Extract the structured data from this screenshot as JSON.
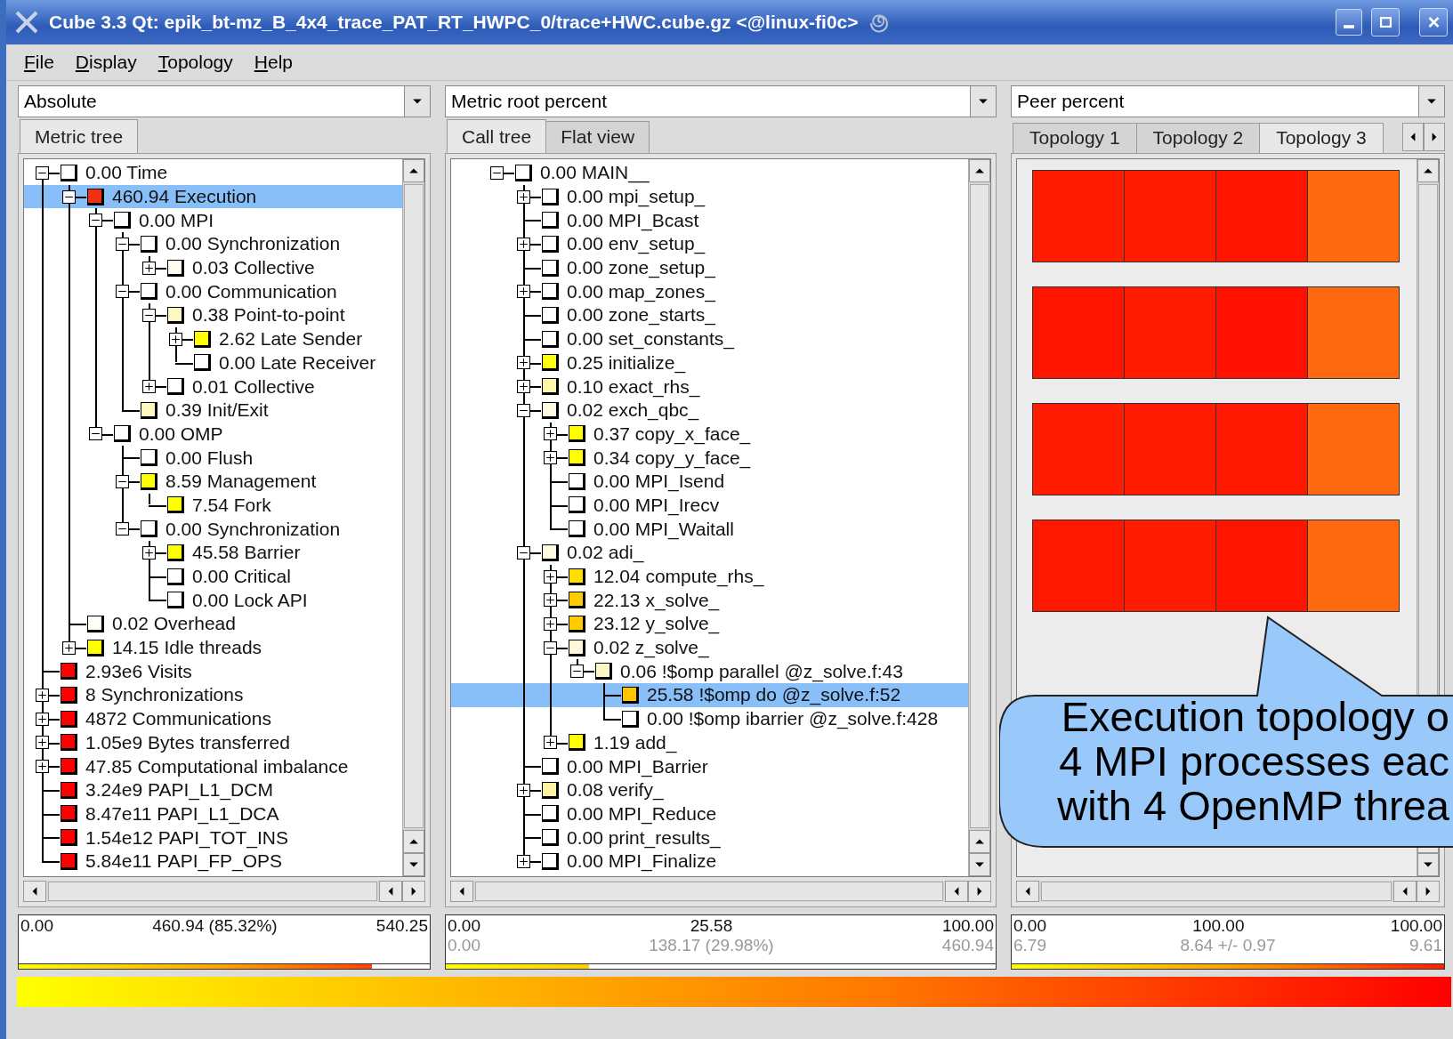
{
  "window": {
    "title": "Cube 3.3 Qt: epik_bt-mz_B_4x4_trace_PAT_RT_HWPC_0/trace+HWC.cube.gz <@linux-fi0c>"
  },
  "menu": [
    "File",
    "Display",
    "Topology",
    "Help"
  ],
  "panels": [
    {
      "kind": "metric_tree",
      "selector": "Absolute",
      "tabs": [
        {
          "label": "Metric tree",
          "selected": true
        }
      ],
      "tree": [
        {
          "text": "0.00 Time",
          "color": "#ffffff",
          "kind": "branch",
          "expanded": true,
          "selected": false,
          "children": [
            {
              "text": "460.94 Execution",
              "color": "#f0300f",
              "kind": "branch",
              "expanded": true,
              "selected": true,
              "children": [
                {
                  "text": "0.00 MPI",
                  "color": "#ffffff",
                  "kind": "branch",
                  "expanded": true,
                  "selected": false,
                  "children": [
                    {
                      "text": "0.00 Synchronization",
                      "color": "#ffffff",
                      "kind": "branch",
                      "expanded": true,
                      "selected": false,
                      "children": [
                        {
                          "text": "0.03 Collective",
                          "color": "#fffdf0",
                          "kind": "branch",
                          "expanded": false,
                          "selected": false
                        }
                      ]
                    },
                    {
                      "text": "0.00 Communication",
                      "color": "#ffffff",
                      "kind": "branch",
                      "expanded": true,
                      "selected": false,
                      "children": [
                        {
                          "text": "0.38 Point-to-point",
                          "color": "#fff8c0",
                          "kind": "branch",
                          "expanded": true,
                          "selected": false,
                          "children": [
                            {
                              "text": "2.62 Late Sender",
                              "color": "#ffff00",
                              "kind": "branch",
                              "expanded": false,
                              "selected": false
                            },
                            {
                              "text": "0.00 Late Receiver",
                              "color": "#ffffff",
                              "kind": "leaf",
                              "selected": false
                            }
                          ]
                        },
                        {
                          "text": "0.01 Collective",
                          "color": "#ffffff",
                          "kind": "branch",
                          "expanded": false,
                          "selected": false
                        }
                      ]
                    },
                    {
                      "text": "0.39 Init/Exit",
                      "color": "#fff8c0",
                      "kind": "leaf",
                      "selected": false
                    }
                  ]
                },
                {
                  "text": "0.00 OMP",
                  "color": "#ffffff",
                  "kind": "branch",
                  "expanded": true,
                  "selected": false,
                  "children": [
                    {
                      "text": "0.00 Flush",
                      "color": "#ffffff",
                      "kind": "leaf",
                      "selected": false
                    },
                    {
                      "text": "8.59 Management",
                      "color": "#ffff00",
                      "kind": "branch",
                      "expanded": true,
                      "selected": false,
                      "children": [
                        {
                          "text": "7.54 Fork",
                          "color": "#ffff00",
                          "kind": "leaf",
                          "selected": false
                        }
                      ]
                    },
                    {
                      "text": "0.00 Synchronization",
                      "color": "#ffffff",
                      "kind": "branch",
                      "expanded": true,
                      "selected": false,
                      "children": [
                        {
                          "text": "45.58 Barrier",
                          "color": "#ffff00",
                          "kind": "branch",
                          "expanded": false,
                          "selected": false
                        },
                        {
                          "text": "0.00 Critical",
                          "color": "#ffffff",
                          "kind": "leaf",
                          "selected": false
                        },
                        {
                          "text": "0.00 Lock API",
                          "color": "#ffffff",
                          "kind": "leaf",
                          "selected": false
                        }
                      ]
                    }
                  ]
                }
              ]
            },
            {
              "text": "0.02 Overhead",
              "color": "#fffef5",
              "kind": "leaf",
              "selected": false
            },
            {
              "text": "14.15 Idle threads",
              "color": "#ffff00",
              "kind": "branch",
              "expanded": false,
              "selected": false
            }
          ]
        },
        {
          "text": "2.93e6 Visits",
          "color": "#ff0000",
          "kind": "leaf",
          "selected": false
        },
        {
          "text": "8 Synchronizations",
          "color": "#ff0000",
          "kind": "branch",
          "expanded": false,
          "selected": false
        },
        {
          "text": "4872 Communications",
          "color": "#ff0000",
          "kind": "branch",
          "expanded": false,
          "selected": false
        },
        {
          "text": "1.05e9 Bytes transferred",
          "color": "#ff0000",
          "kind": "branch",
          "expanded": false,
          "selected": false
        },
        {
          "text": "47.85 Computational imbalance",
          "color": "#ff0000",
          "kind": "branch",
          "expanded": false,
          "selected": false
        },
        {
          "text": "3.24e9 PAPI_L1_DCM",
          "color": "#ff0000",
          "kind": "leaf",
          "selected": false
        },
        {
          "text": "8.47e11 PAPI_L1_DCA",
          "color": "#ff0000",
          "kind": "leaf",
          "selected": false
        },
        {
          "text": "1.54e12 PAPI_TOT_INS",
          "color": "#ff0000",
          "kind": "leaf",
          "selected": false
        },
        {
          "text": "5.84e11 PAPI_FP_OPS",
          "color": "#ff0000",
          "kind": "leaf",
          "selected": false
        }
      ],
      "stats": {
        "min": "0.00",
        "value": "460.94 (85.32%)",
        "max": "540.25",
        "level": 0.86
      }
    },
    {
      "kind": "call_tree",
      "selector": "Metric root percent",
      "tabs": [
        {
          "label": "Call tree",
          "selected": true
        },
        {
          "label": "Flat view",
          "selected": false
        }
      ],
      "tree": [
        {
          "text": "0.00 MAIN__",
          "color": "#ffffff",
          "kind": "branch",
          "expanded": true,
          "selected": false,
          "children": [
            {
              "text": "0.00 mpi_setup_",
              "color": "#ffffff",
              "kind": "branch",
              "expanded": false,
              "selected": false
            },
            {
              "text": "0.00 MPI_Bcast",
              "color": "#ffffff",
              "kind": "leaf",
              "selected": false
            },
            {
              "text": "0.00 env_setup_",
              "color": "#ffffff",
              "kind": "branch",
              "expanded": false,
              "selected": false
            },
            {
              "text": "0.00 zone_setup_",
              "color": "#ffffff",
              "kind": "leaf",
              "selected": false
            },
            {
              "text": "0.00 map_zones_",
              "color": "#ffffff",
              "kind": "branch",
              "expanded": false,
              "selected": false
            },
            {
              "text": "0.00 zone_starts_",
              "color": "#ffffff",
              "kind": "leaf",
              "selected": false
            },
            {
              "text": "0.00 set_constants_",
              "color": "#ffffff",
              "kind": "leaf",
              "selected": false
            },
            {
              "text": "0.25 initialize_",
              "color": "#ffff10",
              "kind": "branch",
              "expanded": false,
              "selected": false
            },
            {
              "text": "0.10 exact_rhs_",
              "color": "#fff8a8",
              "kind": "branch",
              "expanded": false,
              "selected": false
            },
            {
              "text": "0.02 exch_qbc_",
              "color": "#fffbe0",
              "kind": "branch",
              "expanded": true,
              "selected": false,
              "children": [
                {
                  "text": "0.37 copy_x_face_",
                  "color": "#ffff00",
                  "kind": "branch",
                  "expanded": false,
                  "selected": false
                },
                {
                  "text": "0.34 copy_y_face_",
                  "color": "#ffff00",
                  "kind": "branch",
                  "expanded": false,
                  "selected": false
                },
                {
                  "text": "0.00 MPI_Isend",
                  "color": "#ffffff",
                  "kind": "leaf",
                  "selected": false
                },
                {
                  "text": "0.00 MPI_Irecv",
                  "color": "#ffffff",
                  "kind": "leaf",
                  "selected": false
                },
                {
                  "text": "0.00 MPI_Waitall",
                  "color": "#ffffff",
                  "kind": "leaf",
                  "selected": false
                }
              ]
            },
            {
              "text": "0.02 adi_",
              "color": "#fffbe0",
              "kind": "branch",
              "expanded": true,
              "selected": false,
              "children": [
                {
                  "text": "12.04 compute_rhs_",
                  "color": "#ffdd00",
                  "kind": "branch",
                  "expanded": false,
                  "selected": false
                },
                {
                  "text": "22.13 x_solve_",
                  "color": "#ffcc00",
                  "kind": "branch",
                  "expanded": false,
                  "selected": false
                },
                {
                  "text": "23.12 y_solve_",
                  "color": "#ffcc00",
                  "kind": "branch",
                  "expanded": false,
                  "selected": false
                },
                {
                  "text": "0.02 z_solve_",
                  "color": "#fff8dc",
                  "kind": "branch",
                  "expanded": true,
                  "selected": false,
                  "children": [
                    {
                      "text": "0.06 !$omp parallel @z_solve.f:43",
                      "color": "#fff6c8",
                      "kind": "branch",
                      "expanded": true,
                      "selected": false,
                      "children": [
                        {
                          "text": "25.58 !$omp do @z_solve.f:52",
                          "color": "#ffc400",
                          "kind": "leaf",
                          "selected": true
                        },
                        {
                          "text": "0.00 !$omp ibarrier @z_solve.f:428",
                          "color": "#ffffff",
                          "kind": "leaf",
                          "selected": false
                        }
                      ]
                    }
                  ]
                },
                {
                  "text": "1.19 add_",
                  "color": "#ffff00",
                  "kind": "branch",
                  "expanded": false,
                  "selected": false
                }
              ]
            },
            {
              "text": "0.00 MPI_Barrier",
              "color": "#ffffff",
              "kind": "leaf",
              "selected": false
            },
            {
              "text": "0.08 verify_",
              "color": "#fff4a0",
              "kind": "branch",
              "expanded": false,
              "selected": false
            },
            {
              "text": "0.00 MPI_Reduce",
              "color": "#ffffff",
              "kind": "leaf",
              "selected": false
            },
            {
              "text": "0.00 print_results_",
              "color": "#ffffff",
              "kind": "leaf",
              "selected": false
            },
            {
              "text": "0.00 MPI_Finalize",
              "color": "#ffffff",
              "kind": "branch",
              "expanded": false,
              "selected": false
            }
          ]
        }
      ],
      "stats": {
        "min": "0.00",
        "value": "25.58",
        "max": "100.00",
        "sub_min": "0.00",
        "sub_value": "138.17 (29.98%)",
        "sub_max": "460.94",
        "level": 0.26
      }
    },
    {
      "kind": "topology",
      "selector": "Peer percent",
      "tabs": [
        {
          "label": "Topology 1",
          "selected": false
        },
        {
          "label": "Topology 2",
          "selected": false
        },
        {
          "label": "Topology 3",
          "selected": true
        }
      ],
      "topology": [
        {
          "cells": [
            {
              "color": "#ff1c00"
            },
            {
              "color": "#ff1c00"
            },
            {
              "color": "#ff1400"
            },
            {
              "color": "#ff6a10"
            }
          ]
        },
        {
          "cells": [
            {
              "color": "#ff1400"
            },
            {
              "color": "#ff1c00"
            },
            {
              "color": "#ff1000"
            },
            {
              "color": "#ff6a10"
            }
          ]
        },
        {
          "cells": [
            {
              "color": "#ff1c00"
            },
            {
              "color": "#ff1c00"
            },
            {
              "color": "#ff1800"
            },
            {
              "color": "#ff6a10"
            }
          ]
        },
        {
          "cells": [
            {
              "color": "#ff1800"
            },
            {
              "color": "#ff1c00"
            },
            {
              "color": "#ff1400"
            },
            {
              "color": "#ff6a10"
            }
          ]
        }
      ],
      "callout": [
        "Execution topology o",
        "4 MPI processes eac",
        "with 4 OpenMP threa"
      ],
      "stats": {
        "min": "0.00",
        "value": "100.00",
        "max": "100.00",
        "sub_min": "6.79",
        "sub_value": "8.64 +/- 0.97",
        "sub_max": "9.61",
        "level": 1
      }
    }
  ]
}
